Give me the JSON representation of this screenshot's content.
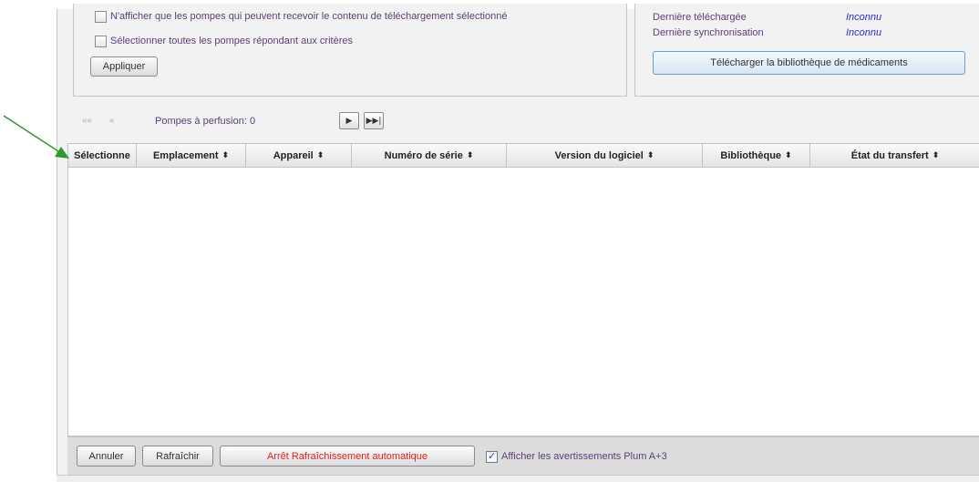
{
  "filters": {
    "only_compatible_label": "N'afficher que les pompes qui peuvent recevoir le contenu de téléchargement sélectionné",
    "select_all_label": "Sélectionner toutes les pompes répondant aux critères",
    "apply_label": "Appliquer"
  },
  "library": {
    "last_downloaded_label": "Dernière téléchargée",
    "last_downloaded_value": "Inconnu",
    "last_sync_label": "Dernière synchronisation",
    "last_sync_value": "Inconnu",
    "download_button": "Télécharger la bibliothèque de médicaments"
  },
  "pager": {
    "first": "««",
    "prev": "«",
    "count_label": "Pompes à perfusion: 0",
    "next_icon": "play-next-icon",
    "last_icon": "skip-last-icon"
  },
  "table": {
    "sort_glyph": "⬍",
    "columns": [
      {
        "label": "Sélectionne",
        "sortable": false
      },
      {
        "label": "Emplacement",
        "sortable": true
      },
      {
        "label": "Appareil",
        "sortable": true
      },
      {
        "label": "Numéro de série",
        "sortable": true
      },
      {
        "label": "Version du logiciel",
        "sortable": true
      },
      {
        "label": "Bibliothèque",
        "sortable": true
      },
      {
        "label": "État du transfert",
        "sortable": true
      }
    ],
    "rows": []
  },
  "footer": {
    "cancel": "Annuler",
    "refresh": "Rafraîchir",
    "stop_auto_refresh": "Arrêt Rafraîchissement automatique",
    "show_warnings_label": "Afficher les avertissements Plum A+3",
    "show_warnings_checked": true
  },
  "colors": {
    "accent_label": "#5a3f79",
    "value_blue": "#2b2bd6",
    "stop_red": "#e02020",
    "annotation_arrow": "#2e9a2e"
  }
}
